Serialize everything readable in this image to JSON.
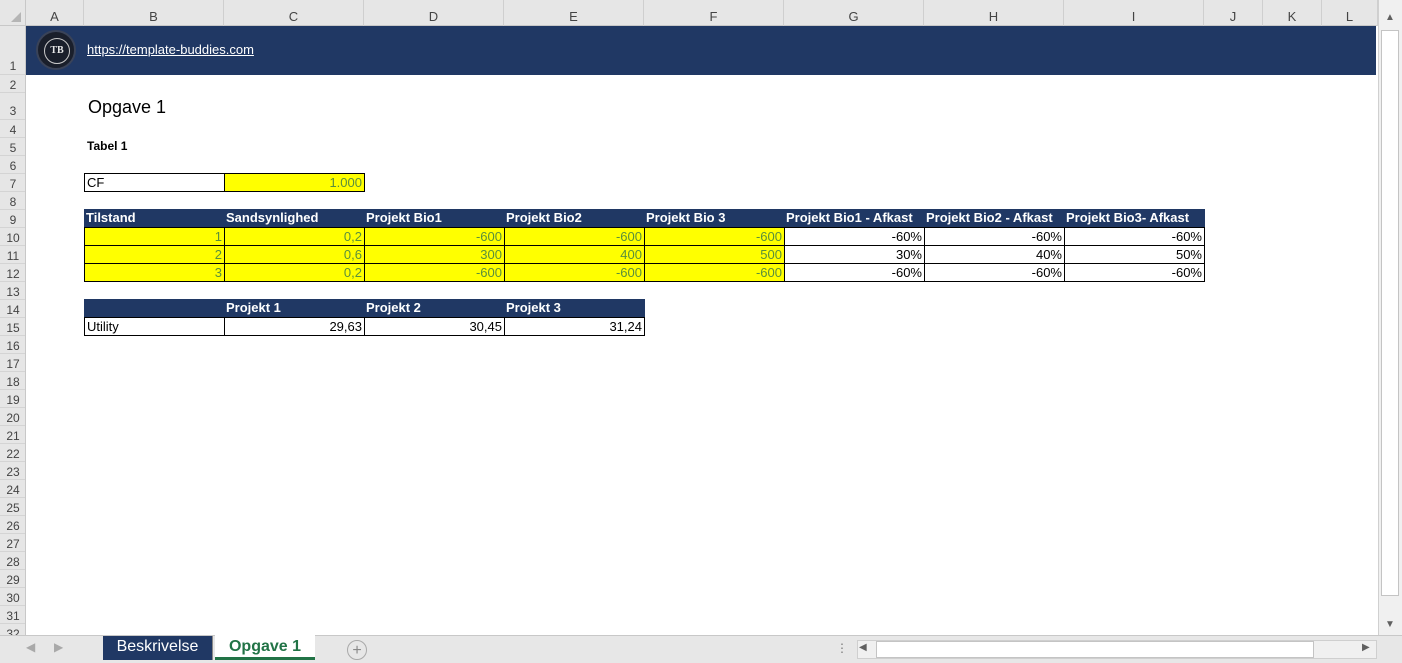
{
  "columns": [
    "A",
    "B",
    "C",
    "D",
    "E",
    "F",
    "G",
    "H",
    "I",
    "J",
    "K",
    "L"
  ],
  "rows": [
    "1",
    "2",
    "3",
    "4",
    "5",
    "6",
    "7",
    "8",
    "9",
    "10",
    "11",
    "12",
    "13",
    "14",
    "15",
    "16",
    "17",
    "18",
    "19",
    "20",
    "21",
    "22",
    "23",
    "24",
    "25",
    "26",
    "27",
    "28",
    "29",
    "30",
    "31",
    "32"
  ],
  "banner": {
    "url": "https://template-buddies.com",
    "logo_text": "TB"
  },
  "sheet_title": "Opgave 1",
  "table_label": "Tabel 1",
  "cf": {
    "label": "CF",
    "value": "1.000"
  },
  "table1": {
    "headers": [
      "Tilstand",
      "Sandsynlighed",
      "Projekt Bio1",
      "Projekt Bio2",
      "Projekt Bio 3",
      "Projekt Bio1 - Afkast",
      "Projekt Bio2 - Afkast",
      "Projekt Bio3- Afkast"
    ],
    "rows": [
      [
        "1",
        "0,2",
        "-600",
        "-600",
        "-600",
        "-60%",
        "-60%",
        "-60%"
      ],
      [
        "2",
        "0,6",
        "300",
        "400",
        "500",
        "30%",
        "40%",
        "50%"
      ],
      [
        "3",
        "0,2",
        "-600",
        "-600",
        "-600",
        "-60%",
        "-60%",
        "-60%"
      ]
    ]
  },
  "table2": {
    "headers": [
      "",
      "Projekt 1",
      "Projekt 2",
      "Projekt 3"
    ],
    "row": [
      "Utility",
      "29,63",
      "30,45",
      "31,24"
    ]
  },
  "tabs": [
    "Beskrivelse",
    "Opgave 1"
  ],
  "active_tab": "Opgave 1",
  "colors": {
    "banner": "#203864",
    "highlight": "#ffff00",
    "accent": "#217346"
  }
}
